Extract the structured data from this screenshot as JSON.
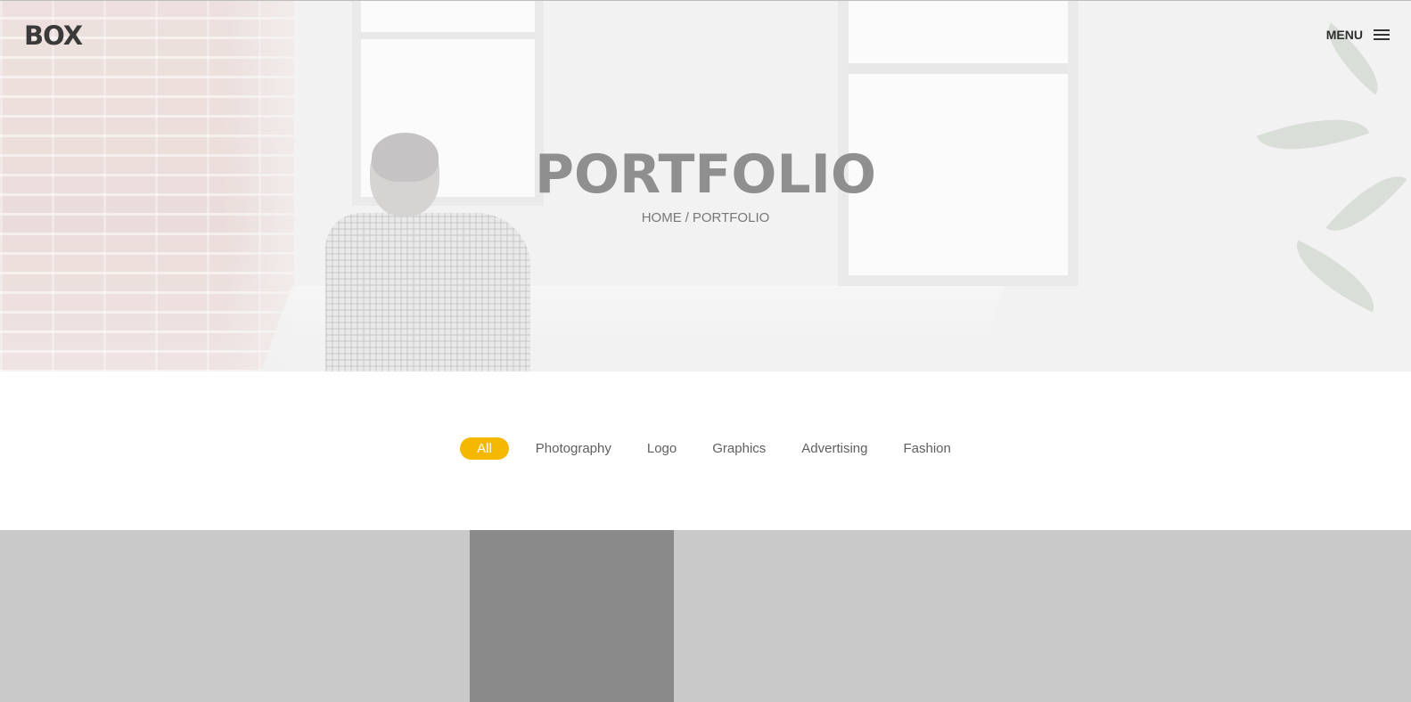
{
  "header": {
    "logo": "BOX",
    "menu_label": "MENU"
  },
  "hero": {
    "title": "PORTFOLIO",
    "breadcrumb": {
      "home": "HOME",
      "separator": "/",
      "current": "PORTFOLIO"
    }
  },
  "filters": {
    "items": [
      {
        "label": "All",
        "active": true
      },
      {
        "label": "Photography",
        "active": false
      },
      {
        "label": "Logo",
        "active": false
      },
      {
        "label": "Graphics",
        "active": false
      },
      {
        "label": "Advertising",
        "active": false
      },
      {
        "label": "Fashion",
        "active": false
      }
    ]
  },
  "colors": {
    "accent": "#f5b800",
    "title": "#8f8f8f",
    "tile_light": "#c9c9c9",
    "tile_dark": "#8a8a8a"
  },
  "icons": {
    "menu": "hamburger-icon"
  }
}
